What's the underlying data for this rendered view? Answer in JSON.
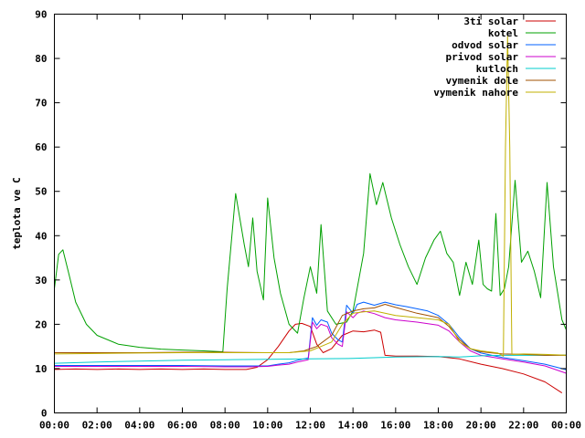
{
  "chart_data": {
    "type": "line",
    "title": "",
    "xlabel": "",
    "ylabel": "teplota ve C",
    "xlim": [
      0,
      24
    ],
    "ylim": [
      0,
      90
    ],
    "grid": false,
    "legend_position": "top-right",
    "x_ticks": [
      0,
      2,
      4,
      6,
      8,
      10,
      12,
      14,
      16,
      18,
      20,
      22,
      24
    ],
    "x_tick_labels": [
      "00:00",
      "02:00",
      "04:00",
      "06:00",
      "08:00",
      "10:00",
      "12:00",
      "14:00",
      "16:00",
      "18:00",
      "20:00",
      "22:00",
      "00:00"
    ],
    "y_ticks": [
      0,
      10,
      20,
      30,
      40,
      50,
      60,
      70,
      80,
      90
    ],
    "y_tick_labels": [
      "0",
      "10",
      "20",
      "30",
      "40",
      "50",
      "60",
      "70",
      "80",
      "90"
    ],
    "series": [
      {
        "name": "3ti solar",
        "color": "#cc0000",
        "points": [
          [
            0,
            9.8
          ],
          [
            1,
            9.9
          ],
          [
            2,
            9.8
          ],
          [
            3,
            9.9
          ],
          [
            4,
            9.8
          ],
          [
            5,
            9.9
          ],
          [
            6,
            9.8
          ],
          [
            7,
            9.9
          ],
          [
            8,
            9.8
          ],
          [
            9,
            9.8
          ],
          [
            9.5,
            10.3
          ],
          [
            10,
            12
          ],
          [
            10.5,
            15
          ],
          [
            11,
            18.5
          ],
          [
            11.3,
            20
          ],
          [
            11.6,
            20.2
          ],
          [
            12,
            19.5
          ],
          [
            12.3,
            15.5
          ],
          [
            12.6,
            13.6
          ],
          [
            13,
            14.5
          ],
          [
            13.5,
            17.5
          ],
          [
            14,
            18.5
          ],
          [
            14.5,
            18.3
          ],
          [
            15,
            18.7
          ],
          [
            15.3,
            18.2
          ],
          [
            15.5,
            13
          ],
          [
            16,
            12.8
          ],
          [
            17,
            12.8
          ],
          [
            18,
            12.7
          ],
          [
            19,
            12.2
          ],
          [
            20,
            11
          ],
          [
            21,
            10
          ],
          [
            22,
            8.8
          ],
          [
            23,
            7
          ],
          [
            23.8,
            4.5
          ]
        ]
      },
      {
        "name": "kotel",
        "color": "#00a000",
        "points": [
          [
            0,
            28
          ],
          [
            0.2,
            35.8
          ],
          [
            0.4,
            36.8
          ],
          [
            0.7,
            31
          ],
          [
            1,
            25
          ],
          [
            1.5,
            20
          ],
          [
            2,
            17.5
          ],
          [
            3,
            15.5
          ],
          [
            4,
            14.8
          ],
          [
            5,
            14.4
          ],
          [
            6,
            14.2
          ],
          [
            7,
            14
          ],
          [
            7.9,
            13.8
          ],
          [
            8.1,
            28
          ],
          [
            8.5,
            49.5
          ],
          [
            8.9,
            38
          ],
          [
            9.1,
            33
          ],
          [
            9.3,
            44
          ],
          [
            9.5,
            32
          ],
          [
            9.8,
            25.5
          ],
          [
            10,
            48.5
          ],
          [
            10.3,
            35
          ],
          [
            10.6,
            27
          ],
          [
            11,
            20
          ],
          [
            11.4,
            18
          ],
          [
            11.7,
            26
          ],
          [
            12,
            33
          ],
          [
            12.3,
            27
          ],
          [
            12.5,
            42.5
          ],
          [
            12.8,
            23
          ],
          [
            13.2,
            20
          ],
          [
            13.7,
            20.5
          ],
          [
            14,
            23
          ],
          [
            14.5,
            36
          ],
          [
            14.8,
            54
          ],
          [
            15.1,
            47
          ],
          [
            15.4,
            52
          ],
          [
            15.8,
            44
          ],
          [
            16.2,
            38
          ],
          [
            16.6,
            33
          ],
          [
            17,
            29
          ],
          [
            17.4,
            35
          ],
          [
            17.8,
            39
          ],
          [
            18.1,
            41
          ],
          [
            18.4,
            36
          ],
          [
            18.7,
            34
          ],
          [
            19,
            26.5
          ],
          [
            19.3,
            34
          ],
          [
            19.6,
            29
          ],
          [
            19.9,
            39
          ],
          [
            20.1,
            29
          ],
          [
            20.3,
            28
          ],
          [
            20.5,
            27.5
          ],
          [
            20.7,
            45
          ],
          [
            20.9,
            26.5
          ],
          [
            21.1,
            28
          ],
          [
            21.3,
            33
          ],
          [
            21.6,
            52.5
          ],
          [
            21.9,
            34
          ],
          [
            22.2,
            36.5
          ],
          [
            22.5,
            32
          ],
          [
            22.8,
            26
          ],
          [
            23.1,
            52
          ],
          [
            23.4,
            33
          ],
          [
            23.8,
            21
          ],
          [
            24.2,
            16.5
          ]
        ]
      },
      {
        "name": "odvod solar",
        "color": "#0060ff",
        "points": [
          [
            0,
            10.7
          ],
          [
            2,
            10.7
          ],
          [
            4,
            10.7
          ],
          [
            6,
            10.7
          ],
          [
            8,
            10.6
          ],
          [
            9,
            10.6
          ],
          [
            10,
            10.6
          ],
          [
            10.5,
            11
          ],
          [
            11,
            11.3
          ],
          [
            11.5,
            12
          ],
          [
            11.9,
            12.4
          ],
          [
            12.1,
            21.5
          ],
          [
            12.3,
            19.8
          ],
          [
            12.5,
            21
          ],
          [
            12.8,
            20.5
          ],
          [
            13,
            18
          ],
          [
            13.3,
            16.5
          ],
          [
            13.5,
            16
          ],
          [
            13.7,
            24.3
          ],
          [
            14,
            22.5
          ],
          [
            14.2,
            24.5
          ],
          [
            14.5,
            25
          ],
          [
            15,
            24.3
          ],
          [
            15.5,
            25
          ],
          [
            16,
            24.4
          ],
          [
            16.5,
            24
          ],
          [
            17,
            23.5
          ],
          [
            17.5,
            23
          ],
          [
            18,
            22
          ],
          [
            18.5,
            20
          ],
          [
            19,
            17
          ],
          [
            19.5,
            14.5
          ],
          [
            20,
            13.5
          ],
          [
            21,
            12.5
          ],
          [
            22,
            11.8
          ],
          [
            23,
            11
          ],
          [
            24.2,
            9.5
          ]
        ]
      },
      {
        "name": "privod solar",
        "color": "#cc00cc",
        "points": [
          [
            0,
            10.5
          ],
          [
            2,
            10.5
          ],
          [
            4,
            10.5
          ],
          [
            6,
            10.5
          ],
          [
            8,
            10.4
          ],
          [
            9,
            10.4
          ],
          [
            10,
            10.5
          ],
          [
            10.5,
            10.8
          ],
          [
            11,
            11
          ],
          [
            11.5,
            11.6
          ],
          [
            11.9,
            12
          ],
          [
            12.1,
            20.5
          ],
          [
            12.3,
            19
          ],
          [
            12.5,
            20
          ],
          [
            12.8,
            19.5
          ],
          [
            13,
            17
          ],
          [
            13.3,
            15.5
          ],
          [
            13.5,
            15
          ],
          [
            13.7,
            22.8
          ],
          [
            14,
            21.5
          ],
          [
            14.2,
            22.5
          ],
          [
            14.5,
            23
          ],
          [
            15,
            22.4
          ],
          [
            15.5,
            21.5
          ],
          [
            16,
            21
          ],
          [
            17,
            20.5
          ],
          [
            18,
            19.8
          ],
          [
            18.5,
            18.5
          ],
          [
            19,
            16
          ],
          [
            19.5,
            14
          ],
          [
            20,
            13
          ],
          [
            21,
            12.2
          ],
          [
            22,
            11.5
          ],
          [
            23,
            10.6
          ],
          [
            24.2,
            8.6
          ]
        ]
      },
      {
        "name": "kutloch",
        "color": "#00cccc",
        "points": [
          [
            0,
            11.2
          ],
          [
            2,
            11.5
          ],
          [
            4,
            11.7
          ],
          [
            6,
            11.9
          ],
          [
            8,
            12.0
          ],
          [
            10,
            12.1
          ],
          [
            12,
            12.2
          ],
          [
            14,
            12.3
          ],
          [
            16,
            12.6
          ],
          [
            18,
            12.7
          ],
          [
            19,
            12.6
          ],
          [
            20,
            12.9
          ],
          [
            21,
            13
          ],
          [
            22,
            13
          ],
          [
            23,
            13
          ],
          [
            24.2,
            13.1
          ]
        ]
      },
      {
        "name": "vymenik dole",
        "color": "#a05000",
        "points": [
          [
            0,
            13.6
          ],
          [
            2,
            13.6
          ],
          [
            4,
            13.6
          ],
          [
            6,
            13.7
          ],
          [
            8,
            13.7
          ],
          [
            10,
            13.6
          ],
          [
            11,
            13.6
          ],
          [
            11.7,
            14
          ],
          [
            12.3,
            15
          ],
          [
            13,
            17.5
          ],
          [
            13.5,
            22
          ],
          [
            14,
            23
          ],
          [
            14.5,
            23.5
          ],
          [
            15,
            23.7
          ],
          [
            15.5,
            24.5
          ],
          [
            16,
            23.8
          ],
          [
            17,
            22.5
          ],
          [
            18,
            21.5
          ],
          [
            18.5,
            19.5
          ],
          [
            19,
            16.5
          ],
          [
            19.5,
            14.5
          ],
          [
            20,
            13.8
          ],
          [
            21,
            13.3
          ],
          [
            22,
            13.2
          ],
          [
            23,
            13
          ],
          [
            24.2,
            13
          ]
        ]
      },
      {
        "name": "vymenik nahore",
        "color": "#c0b000",
        "points": [
          [
            0,
            13.3
          ],
          [
            2,
            13.4
          ],
          [
            4,
            13.5
          ],
          [
            6,
            13.6
          ],
          [
            8,
            13.6
          ],
          [
            10,
            13.6
          ],
          [
            11,
            13.6
          ],
          [
            11.5,
            13.8
          ],
          [
            12,
            14
          ],
          [
            12.5,
            15
          ],
          [
            13,
            16
          ],
          [
            13.5,
            20
          ],
          [
            14,
            22.5
          ],
          [
            14.5,
            22.8
          ],
          [
            15,
            23
          ],
          [
            15.5,
            22.5
          ],
          [
            16,
            22
          ],
          [
            17,
            21.5
          ],
          [
            18,
            21
          ],
          [
            18.5,
            20
          ],
          [
            19,
            16
          ],
          [
            19.5,
            14.5
          ],
          [
            20,
            14
          ],
          [
            20.8,
            13.5
          ],
          [
            21.05,
            12.8
          ],
          [
            21.15,
            60
          ],
          [
            21.25,
            85
          ],
          [
            21.35,
            60
          ],
          [
            21.45,
            13.2
          ],
          [
            22,
            13.3
          ],
          [
            23,
            13.2
          ],
          [
            24.2,
            13
          ]
        ]
      }
    ]
  }
}
